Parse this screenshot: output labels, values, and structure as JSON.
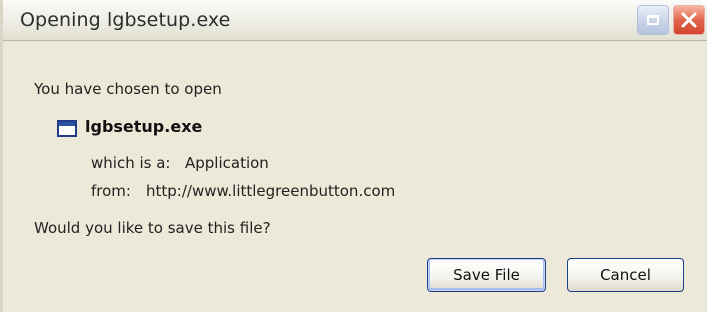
{
  "window": {
    "title": "Opening lgbsetup.exe"
  },
  "icons": {
    "restore": "restore-icon",
    "close": "close-icon",
    "file": "application-window-icon"
  },
  "colors": {
    "dialog_bg": "#ece9d8",
    "close_button": "#e2644c",
    "restore_button": "#c9d3e8",
    "button_border": "#1d3f8a",
    "icon_blue": "#2a4fa3"
  },
  "content": {
    "intro": "You have chosen to open",
    "file_name": "lgbsetup.exe",
    "type_label": "which is a:",
    "type_value": "Application",
    "from_label": "from:",
    "from_value": "http://www.littlegreenbutton.com",
    "question": "Would you like to save this file?"
  },
  "buttons": {
    "save": "Save File",
    "cancel": "Cancel"
  }
}
